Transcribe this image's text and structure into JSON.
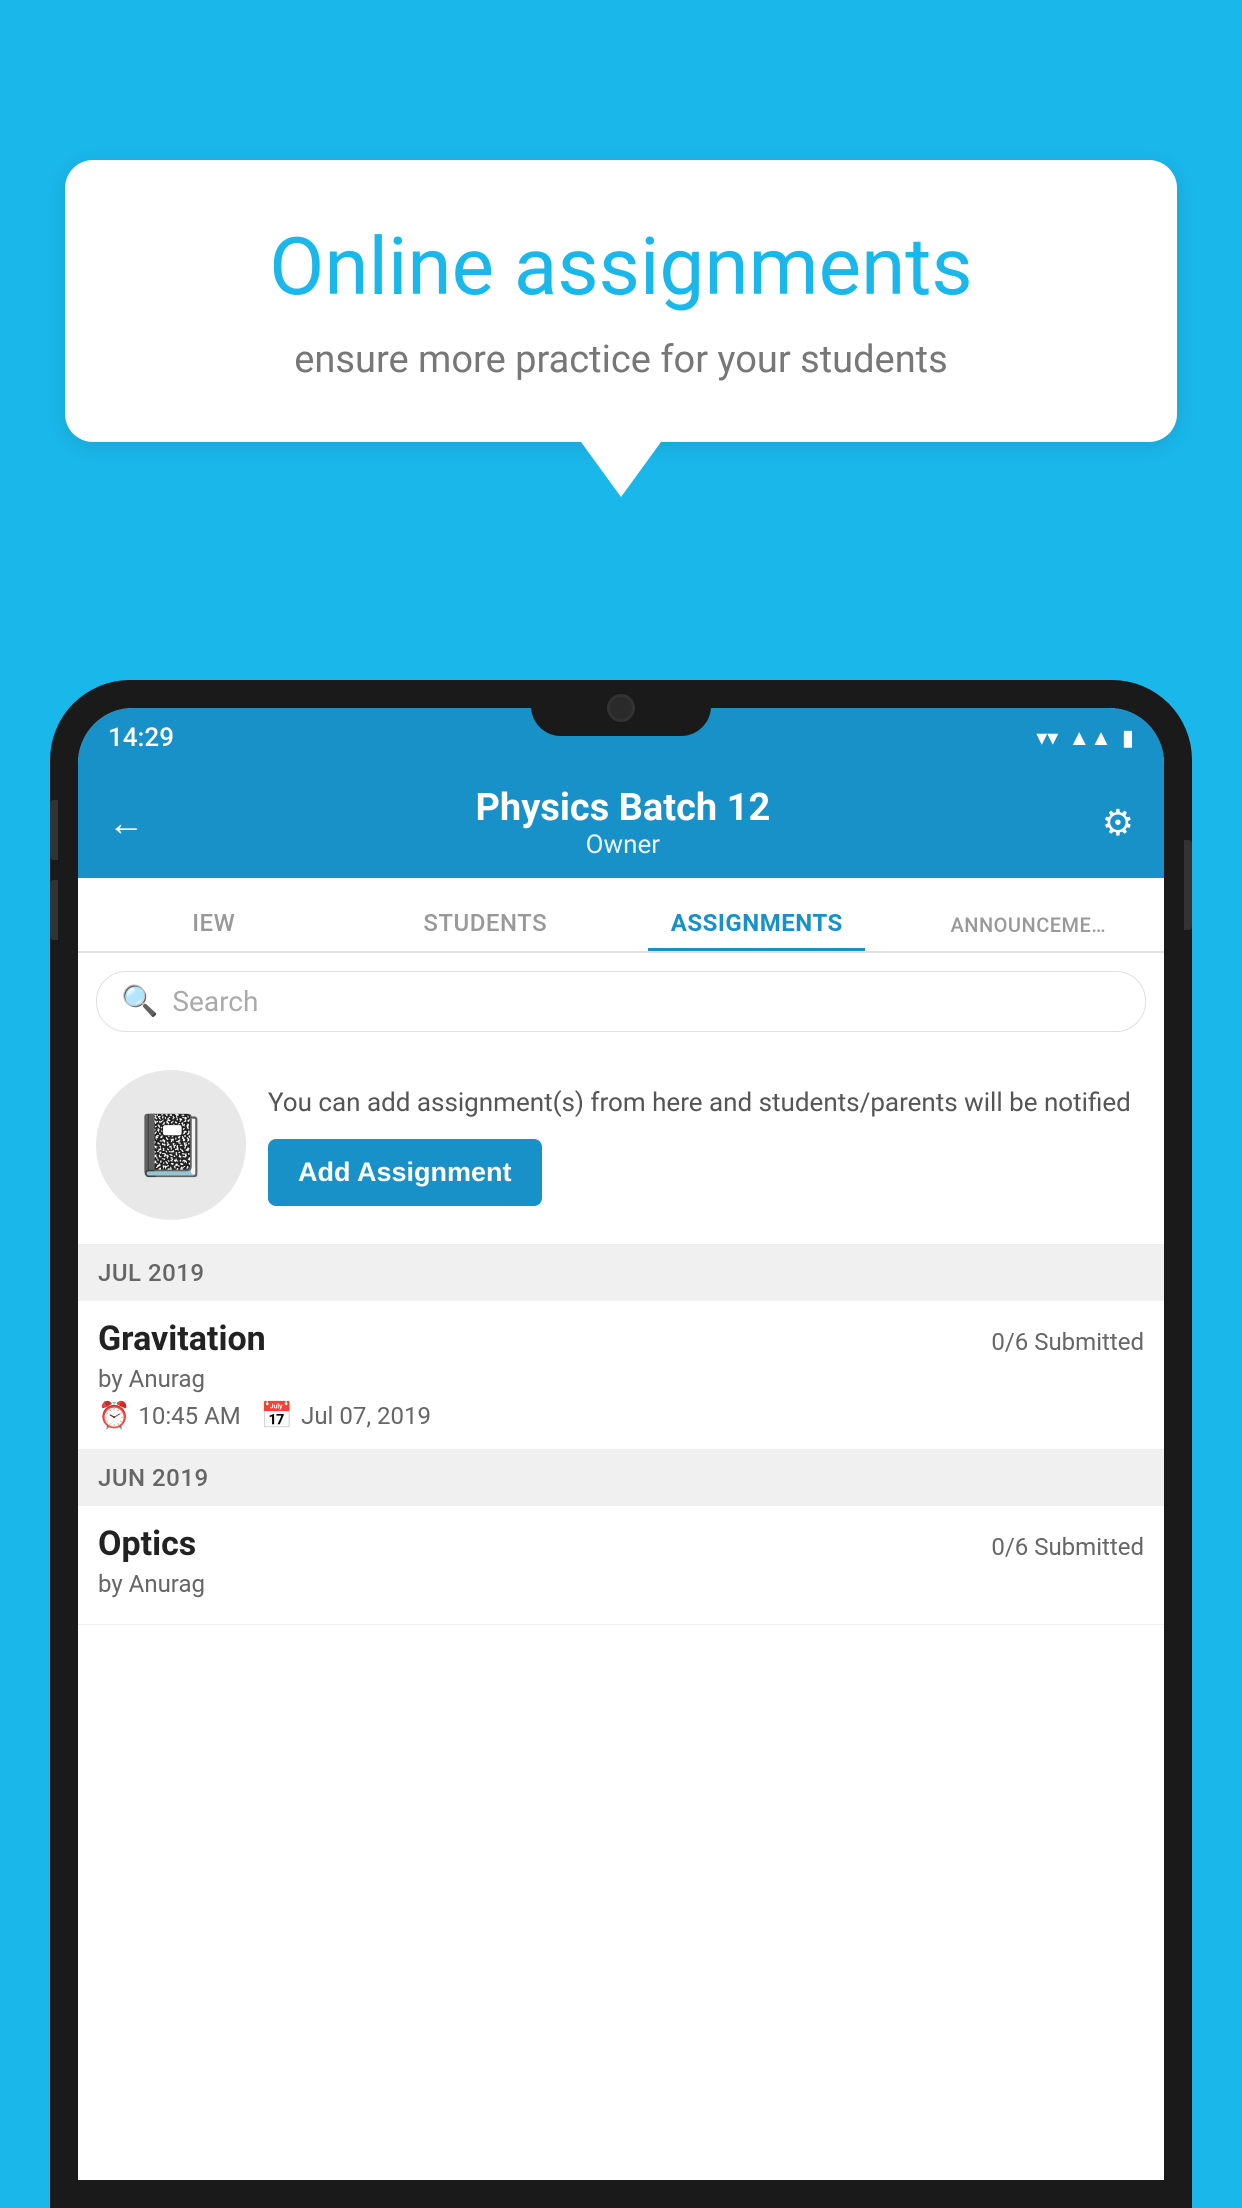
{
  "background_color": "#1ab7ea",
  "speech_bubble": {
    "title": "Online assignments",
    "subtitle": "ensure more practice for your students"
  },
  "phone": {
    "status_bar": {
      "time": "14:29",
      "icons": [
        "wifi",
        "signal",
        "battery"
      ]
    },
    "header": {
      "title": "Physics Batch 12",
      "subtitle": "Owner",
      "back_label": "←",
      "gear_label": "⚙"
    },
    "tabs": [
      {
        "label": "IEW",
        "active": false
      },
      {
        "label": "STUDENTS",
        "active": false
      },
      {
        "label": "ASSIGNMENTS",
        "active": true
      },
      {
        "label": "ANNOUNCEMENTS",
        "active": false
      }
    ],
    "search": {
      "placeholder": "Search"
    },
    "add_assignment_section": {
      "description": "You can add assignment(s) from here and students/parents will be notified",
      "button_label": "Add Assignment"
    },
    "sections": [
      {
        "header": "JUL 2019",
        "items": [
          {
            "name": "Gravitation",
            "submitted": "0/6 Submitted",
            "by": "by Anurag",
            "time": "10:45 AM",
            "date": "Jul 07, 2019"
          }
        ]
      },
      {
        "header": "JUN 2019",
        "items": [
          {
            "name": "Optics",
            "submitted": "0/6 Submitted",
            "by": "by Anurag",
            "time": "",
            "date": ""
          }
        ]
      }
    ]
  }
}
